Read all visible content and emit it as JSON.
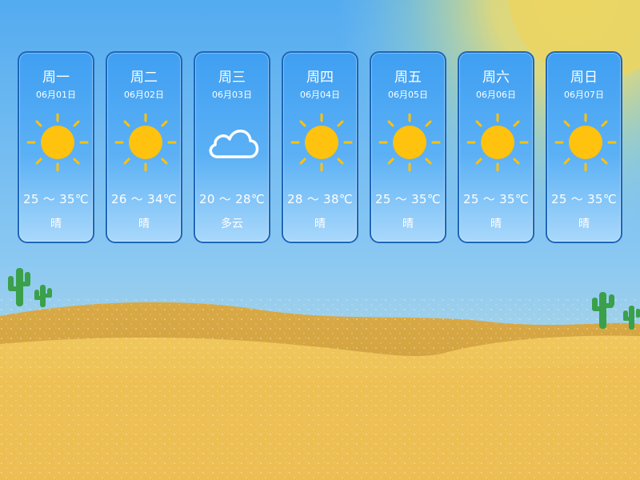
{
  "colors": {
    "sun": "#ffc20e",
    "card_border": "#1e66b8",
    "sky": "#5ab4f4",
    "sand": "#e7b84a"
  },
  "forecast": [
    {
      "day": "周一",
      "date": "06月01日",
      "icon": "sun-icon",
      "temp": "25 ～ 35℃",
      "condition": "晴"
    },
    {
      "day": "周二",
      "date": "06月02日",
      "icon": "sun-icon",
      "temp": "26 ～ 34℃",
      "condition": "晴"
    },
    {
      "day": "周三",
      "date": "06月03日",
      "icon": "cloud-icon",
      "temp": "20 ～ 28℃",
      "condition": "多云"
    },
    {
      "day": "周四",
      "date": "06月04日",
      "icon": "sun-icon",
      "temp": "28 ～ 38℃",
      "condition": "晴"
    },
    {
      "day": "周五",
      "date": "06月05日",
      "icon": "sun-icon",
      "temp": "25 ～ 35℃",
      "condition": "晴"
    },
    {
      "day": "周六",
      "date": "06月06日",
      "icon": "sun-icon",
      "temp": "25 ～ 35℃",
      "condition": "晴"
    },
    {
      "day": "周日",
      "date": "06月07日",
      "icon": "sun-icon",
      "temp": "25 ～ 35℃",
      "condition": "晴"
    }
  ]
}
